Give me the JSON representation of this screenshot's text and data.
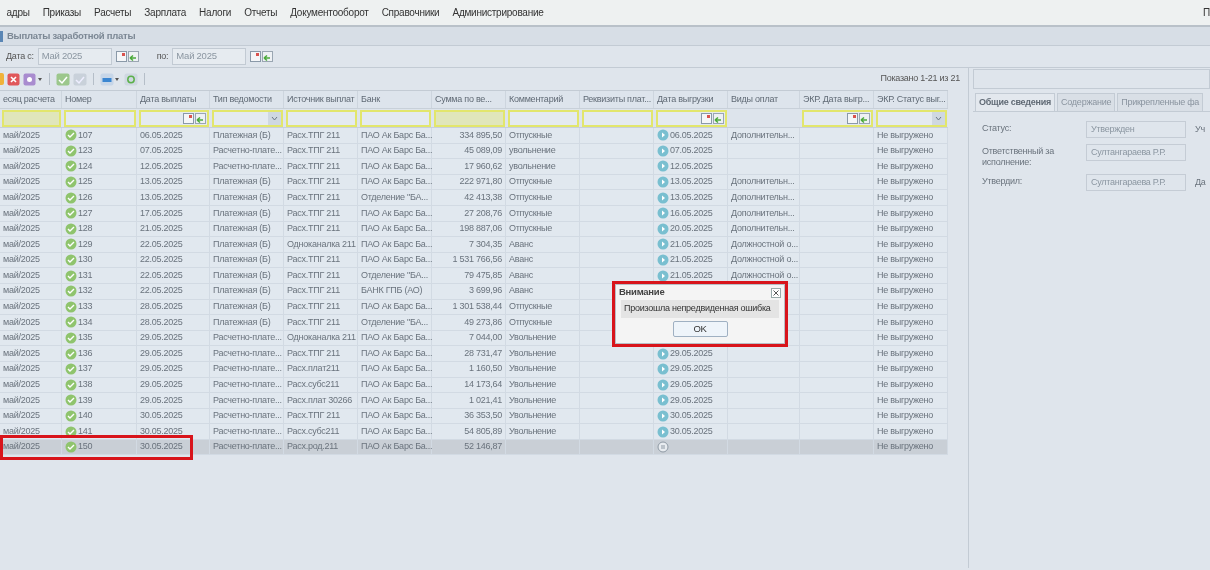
{
  "menu": [
    {
      "label": "адры"
    },
    {
      "label": "Приказы"
    },
    {
      "label": "Расчеты"
    },
    {
      "label": "Зарплата"
    },
    {
      "label": "Налоги"
    },
    {
      "label": "Отчеты"
    },
    {
      "label": "Документооборот"
    },
    {
      "label": "Справочники"
    },
    {
      "label": "Администрирование"
    }
  ],
  "menu_right": "П",
  "panel_title": "Выплаты заработной платы",
  "date_filter": {
    "from_label": "Дата с:",
    "from_value": "Май 2025",
    "to_label": "по:",
    "to_value": "Май 2025"
  },
  "record_count": "Показано 1-21 из 21",
  "table": {
    "columns": [
      {
        "label": "есяц расчета",
        "kind": "text",
        "tinted": true
      },
      {
        "label": "Номер",
        "kind": "text",
        "tinted": false
      },
      {
        "label": "Дата выплаты",
        "kind": "date",
        "tinted": false
      },
      {
        "label": "Тип ведомости",
        "kind": "select",
        "tinted": false
      },
      {
        "label": "Источник выплат",
        "kind": "text",
        "tinted": false
      },
      {
        "label": "Банк",
        "kind": "text",
        "tinted": false
      },
      {
        "label": "Сумма по ве...",
        "kind": "text",
        "tinted": true
      },
      {
        "label": "Комментарий",
        "kind": "text",
        "tinted": false
      },
      {
        "label": "Реквизиты плат...",
        "kind": "text",
        "tinted": false
      },
      {
        "label": "Дата выгрузки",
        "kind": "date",
        "tinted": false
      },
      {
        "label": "Виды оплат",
        "kind": "plain",
        "tinted": false
      },
      {
        "label": "ЭКР. Дата выгр...",
        "kind": "date",
        "tinted": false
      },
      {
        "label": "ЭКР. Статус выг...",
        "kind": "select",
        "tinted": false
      }
    ],
    "rows": [
      {
        "month": "май/2025",
        "number": "107",
        "date": "06.05.2025",
        "type": "Платежная (Б)",
        "source": "Расх.ТПГ 211",
        "bank": "ПАО Ак Барс Ба...",
        "amount": "334 895,50",
        "comment": "Отпускные",
        "unloaded": true,
        "unload_date": "06.05.2025",
        "pay_types": "Дополнительн...",
        "ekr_status": "Не выгружено",
        "selected": false,
        "highlighted": false
      },
      {
        "month": "май/2025",
        "number": "123",
        "date": "07.05.2025",
        "type": "Расчетно-плате...",
        "source": "Расх.ТПГ 211",
        "bank": "ПАО Ак Барс Ба...",
        "amount": "45 089,09",
        "comment": "увольнение",
        "unloaded": true,
        "unload_date": "07.05.2025",
        "ekr_status": "Не выгружено",
        "selected": false,
        "highlighted": false
      },
      {
        "month": "май/2025",
        "number": "124",
        "date": "12.05.2025",
        "type": "Расчетно-плате...",
        "source": "Расх.ТПГ 211",
        "bank": "ПАО Ак Барс Ба...",
        "amount": "17 960,62",
        "comment": "увольнение",
        "unloaded": true,
        "unload_date": "12.05.2025",
        "ekr_status": "Не выгружено",
        "selected": false,
        "highlighted": false
      },
      {
        "month": "май/2025",
        "number": "125",
        "date": "13.05.2025",
        "type": "Платежная (Б)",
        "source": "Расх.ТПГ 211",
        "bank": "ПАО Ак Барс Ба...",
        "amount": "222 971,80",
        "comment": "Отпускные",
        "unloaded": true,
        "unload_date": "13.05.2025",
        "pay_types": "Дополнительн...",
        "ekr_status": "Не выгружено",
        "selected": false,
        "highlighted": false
      },
      {
        "month": "май/2025",
        "number": "126",
        "date": "13.05.2025",
        "type": "Платежная (Б)",
        "source": "Расх.ТПГ 211",
        "bank": "Отделение \"БА...",
        "amount": "42 413,38",
        "comment": "Отпускные",
        "unloaded": true,
        "unload_date": "13.05.2025",
        "pay_types": "Дополнительн...",
        "ekr_status": "Не выгружено",
        "selected": false,
        "highlighted": false
      },
      {
        "month": "май/2025",
        "number": "127",
        "date": "17.05.2025",
        "type": "Платежная (Б)",
        "source": "Расх.ТПГ 211",
        "bank": "ПАО Ак Барс Ба...",
        "amount": "27 208,76",
        "comment": "Отпускные",
        "unloaded": true,
        "unload_date": "16.05.2025",
        "pay_types": "Дополнительн...",
        "ekr_status": "Не выгружено",
        "selected": false,
        "highlighted": false
      },
      {
        "month": "май/2025",
        "number": "128",
        "date": "21.05.2025",
        "type": "Платежная (Б)",
        "source": "Расх.ТПГ 211",
        "bank": "ПАО Ак Барс Ба...",
        "amount": "198 887,06",
        "comment": "Отпускные",
        "unloaded": true,
        "unload_date": "20.05.2025",
        "pay_types": "Дополнительн...",
        "ekr_status": "Не выгружено",
        "selected": false,
        "highlighted": false
      },
      {
        "month": "май/2025",
        "number": "129",
        "date": "22.05.2025",
        "type": "Платежная (Б)",
        "source": "Одноканалка 211",
        "bank": "ПАО Ак Барс Ба...",
        "amount": "7 304,35",
        "comment": "Аванс",
        "unloaded": true,
        "unload_date": "21.05.2025",
        "pay_types": "Должностной о...",
        "ekr_status": "Не выгружено",
        "selected": false,
        "highlighted": false
      },
      {
        "month": "май/2025",
        "number": "130",
        "date": "22.05.2025",
        "type": "Платежная (Б)",
        "source": "Расх.ТПГ 211",
        "bank": "ПАО Ак Барс Ба...",
        "amount": "1 531 766,56",
        "comment": "Аванс",
        "unloaded": true,
        "unload_date": "21.05.2025",
        "pay_types": "Должностной о...",
        "ekr_status": "Не выгружено",
        "selected": false,
        "highlighted": false
      },
      {
        "month": "май/2025",
        "number": "131",
        "date": "22.05.2025",
        "type": "Платежная (Б)",
        "source": "Расх.ТПГ 211",
        "bank": "Отделение \"БА...",
        "amount": "79 475,85",
        "comment": "Аванс",
        "unloaded": true,
        "unload_date": "21.05.2025",
        "pay_types": "Должностной о...",
        "ekr_status": "Не выгружено",
        "selected": false,
        "highlighted": false
      },
      {
        "month": "май/2025",
        "number": "132",
        "date": "22.05.2025",
        "type": "Платежная (Б)",
        "source": "Расх.ТПГ 211",
        "bank": "БАНК ГПБ (АО)",
        "amount": "3 699,96",
        "comment": "Аванс",
        "ekr_status": "Не выгружено",
        "selected": false,
        "highlighted": false
      },
      {
        "month": "май/2025",
        "number": "133",
        "date": "28.05.2025",
        "type": "Платежная (Б)",
        "source": "Расх.ТПГ 211",
        "bank": "ПАО Ак Барс Ба...",
        "amount": "1 301 538,44",
        "comment": "Отпускные",
        "ekr_status": "Не выгружено",
        "selected": false,
        "highlighted": false
      },
      {
        "month": "май/2025",
        "number": "134",
        "date": "28.05.2025",
        "type": "Платежная (Б)",
        "source": "Расх.ТПГ 211",
        "bank": "Отделение \"БА...",
        "amount": "49 273,86",
        "comment": "Отпускные",
        "ekr_status": "Не выгружено",
        "selected": false,
        "highlighted": false
      },
      {
        "month": "май/2025",
        "number": "135",
        "date": "29.05.2025",
        "type": "Расчетно-плате...",
        "source": "Одноканалка 211",
        "bank": "ПАО Ак Барс Ба...",
        "amount": "7 044,00",
        "comment": "Увольнение",
        "ekr_status": "Не выгружено",
        "selected": false,
        "highlighted": false
      },
      {
        "month": "май/2025",
        "number": "136",
        "date": "29.05.2025",
        "type": "Расчетно-плате...",
        "source": "Расх.ТПГ 211",
        "bank": "ПАО Ак Барс Ба...",
        "amount": "28 731,47",
        "comment": "Увольнение",
        "unloaded": true,
        "unload_date": "29.05.2025",
        "ekr_status": "Не выгружено",
        "selected": false,
        "highlighted": false
      },
      {
        "month": "май/2025",
        "number": "137",
        "date": "29.05.2025",
        "type": "Расчетно-плате...",
        "source": "Расх.плат211",
        "bank": "ПАО Ак Барс Ба...",
        "amount": "1 160,50",
        "comment": "Увольнение",
        "unloaded": true,
        "unload_date": "29.05.2025",
        "ekr_status": "Не выгружено",
        "selected": false,
        "highlighted": false
      },
      {
        "month": "май/2025",
        "number": "138",
        "date": "29.05.2025",
        "type": "Расчетно-плате...",
        "source": "Расх.субс211",
        "bank": "ПАО Ак Барс Ба...",
        "amount": "14 173,64",
        "comment": "Увольнение",
        "unloaded": true,
        "unload_date": "29.05.2025",
        "ekr_status": "Не выгружено",
        "selected": false,
        "highlighted": false
      },
      {
        "month": "май/2025",
        "number": "139",
        "date": "29.05.2025",
        "type": "Расчетно-плате...",
        "source": "Расх.плат 30266",
        "bank": "ПАО Ак Барс Ба...",
        "amount": "1 021,41",
        "comment": "Увольнение",
        "unloaded": true,
        "unload_date": "29.05.2025",
        "ekr_status": "Не выгружено",
        "selected": false,
        "highlighted": false
      },
      {
        "month": "май/2025",
        "number": "140",
        "date": "30.05.2025",
        "type": "Расчетно-плате...",
        "source": "Расх.ТПГ 211",
        "bank": "ПАО Ак Барс Ба...",
        "amount": "36 353,50",
        "comment": "Увольнение",
        "unloaded": true,
        "unload_date": "30.05.2025",
        "ekr_status": "Не выгружено",
        "selected": false,
        "highlighted": false
      },
      {
        "month": "май/2025",
        "number": "141",
        "date": "30.05.2025",
        "type": "Расчетно-плате...",
        "source": "Расх.субс211",
        "bank": "ПАО Ак Барс Ба...",
        "amount": "54 805,89",
        "comment": "Увольнение",
        "unloaded": true,
        "unload_date": "30.05.2025",
        "ekr_status": "Не выгружено",
        "selected": false,
        "highlighted": false
      },
      {
        "month": "май/2025",
        "number": "150",
        "date": "30.05.2025",
        "type": "Расчетно-плате...",
        "source": "Расх.род.211",
        "bank": "ПАО Ак Барс Ба...",
        "amount": "52 146,87",
        "unloaded": false,
        "ekr_status": "Не выгружено",
        "selected": true,
        "highlighted": true
      }
    ]
  },
  "details": {
    "tabs": [
      {
        "label": "Общие сведения",
        "selected": true
      },
      {
        "label": "Содержание",
        "selected": false
      },
      {
        "label": "Прикрепленные фа",
        "selected": false
      }
    ],
    "fields": [
      {
        "label": "Статус:",
        "value": "Утвержден",
        "side_label": "Уч"
      },
      {
        "label": "Ответственный за исполнение:",
        "value": "Султангараева Р.Р."
      },
      {
        "label": "Утвердил:",
        "value": "Султангараева Р.Р.",
        "side_label": "Да"
      }
    ]
  },
  "dialog": {
    "title": "Внимание",
    "message": "Произошла непредвиденная ошибка",
    "button": "OK",
    "highlighted": true
  }
}
